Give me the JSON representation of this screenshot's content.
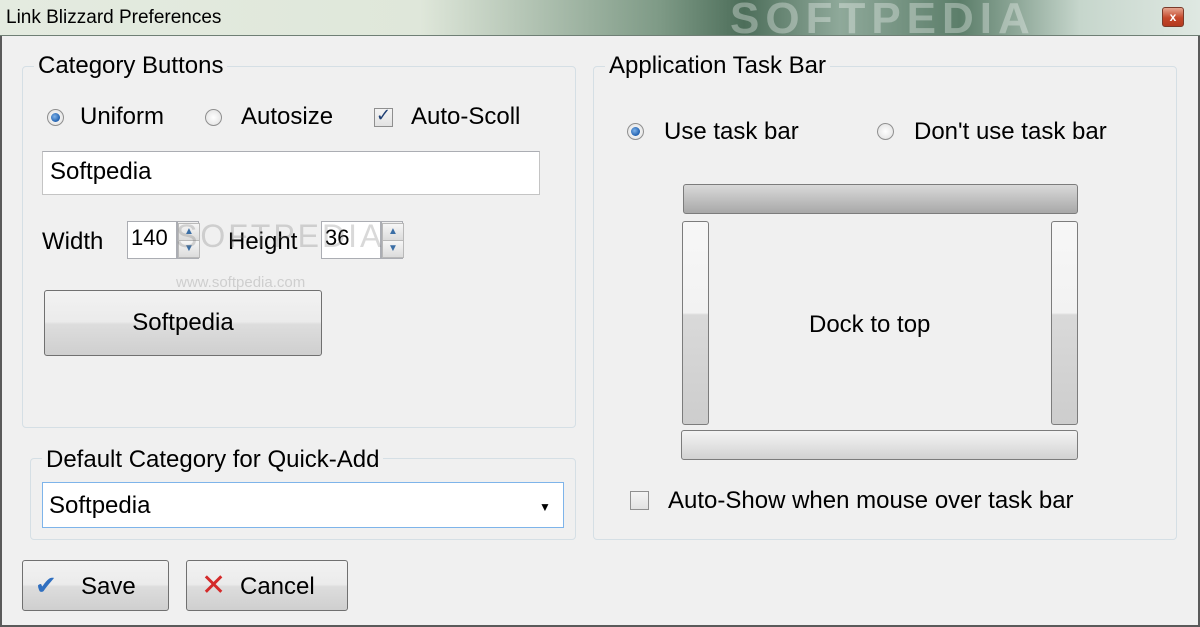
{
  "window": {
    "title": "Link Blizzard Preferences",
    "close_glyph": "x",
    "watermark": "SOFTPEDIA"
  },
  "category_buttons": {
    "legend": "Category Buttons",
    "radio_uniform": {
      "label": "Uniform",
      "selected": true
    },
    "radio_autosize": {
      "label": "Autosize",
      "selected": false
    },
    "auto_scroll": {
      "label": "Auto-Scoll",
      "checked": true
    },
    "name_value": "Softpedia",
    "width_label": "Width",
    "width_value": "140",
    "height_label": "Height",
    "height_value": "36",
    "preview_button_label": "Softpedia",
    "watermark_text": "SOFTPEDIA",
    "watermark_url": "www.softpedia.com"
  },
  "quick_add": {
    "legend": "Default Category for Quick-Add",
    "selected_value": "Softpedia",
    "arrow_glyph": "▼"
  },
  "task_bar": {
    "legend": "Application Task Bar",
    "radio_use": {
      "label": "Use task bar",
      "selected": true
    },
    "radio_dont_use": {
      "label": "Don't use task bar",
      "selected": false
    },
    "dock_label": "Dock to top",
    "auto_show": {
      "label": "Auto-Show when mouse over task bar",
      "checked": false
    }
  },
  "footer": {
    "save_label": "Save",
    "save_icon": "checkmark-icon",
    "cancel_label": "Cancel",
    "cancel_icon": "x-icon"
  },
  "colors": {
    "accent_blue": "#1f5fae",
    "cancel_red": "#d42a2a",
    "save_blue": "#2f6fc0"
  }
}
